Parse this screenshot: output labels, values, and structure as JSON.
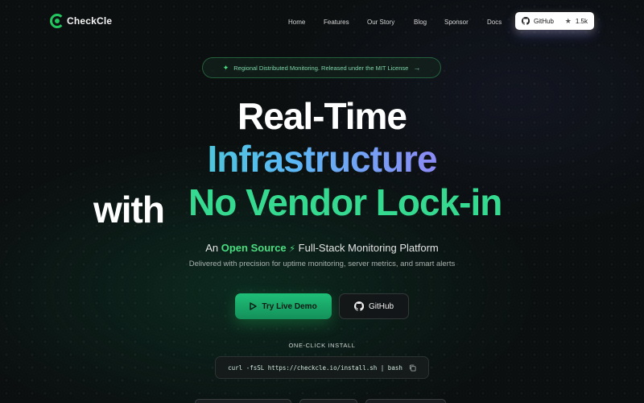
{
  "nav": {
    "logo_text": "CheckCle",
    "links": [
      "Home",
      "Features",
      "Our Story",
      "Blog",
      "Sponsor",
      "Docs"
    ],
    "github_label": "GitHub",
    "stars": "1.5k"
  },
  "announcement": {
    "text": "Regional Distributed Monitoring. Released under the MIT License"
  },
  "hero": {
    "line1": "Real-Time",
    "line2": "Infrastructure",
    "line3a": "with",
    "line3b": "No Vendor Lock-in"
  },
  "subtitle": {
    "prefix": "An",
    "highlight": "Open Source",
    "suffix": "Full-Stack Monitoring Platform"
  },
  "tagline": "Delivered with precision for uptime monitoring, server metrics, and smart alerts",
  "buttons": {
    "demo": "Try Live Demo",
    "github": "GitHub"
  },
  "install": {
    "label": "ONE-CLICK INSTALL",
    "command": "curl -fsSL https://checkcle.io/install.sh | bash"
  },
  "colors": {
    "accent_green": "#22c55e",
    "background": "#0b0f10"
  },
  "icons": [
    "logo-icon",
    "github-icon",
    "star-icon",
    "sparkle-icon",
    "arrow-right-icon",
    "play-icon",
    "copy-icon",
    "lightning-icon"
  ]
}
